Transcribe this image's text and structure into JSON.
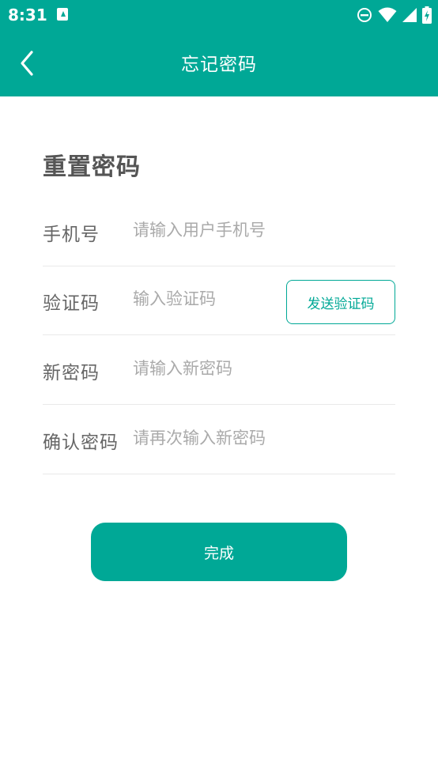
{
  "status_bar": {
    "time": "8:31",
    "icons": [
      "notification-a-icon",
      "do-not-disturb-icon",
      "wifi-icon",
      "signal-icon",
      "battery-charging-icon"
    ]
  },
  "app_bar": {
    "title": "忘记密码",
    "back_icon": "chevron-left-icon",
    "background_color": "#00a896"
  },
  "form": {
    "heading": "重置密码",
    "fields": [
      {
        "label": "手机号",
        "placeholder": "请输入用户手机号",
        "value": ""
      },
      {
        "label": "验证码",
        "placeholder": "输入验证码",
        "value": ""
      },
      {
        "label": "新密码",
        "placeholder": "请输入新密码",
        "value": ""
      },
      {
        "label": "确认密码",
        "placeholder": "请再次输入新密码",
        "value": ""
      }
    ],
    "send_code_label": "发送验证码",
    "submit_label": "完成"
  },
  "colors": {
    "accent": "#00a896",
    "label": "#666666",
    "placeholder": "#aaaaaa",
    "divider": "#e9e9e9"
  }
}
